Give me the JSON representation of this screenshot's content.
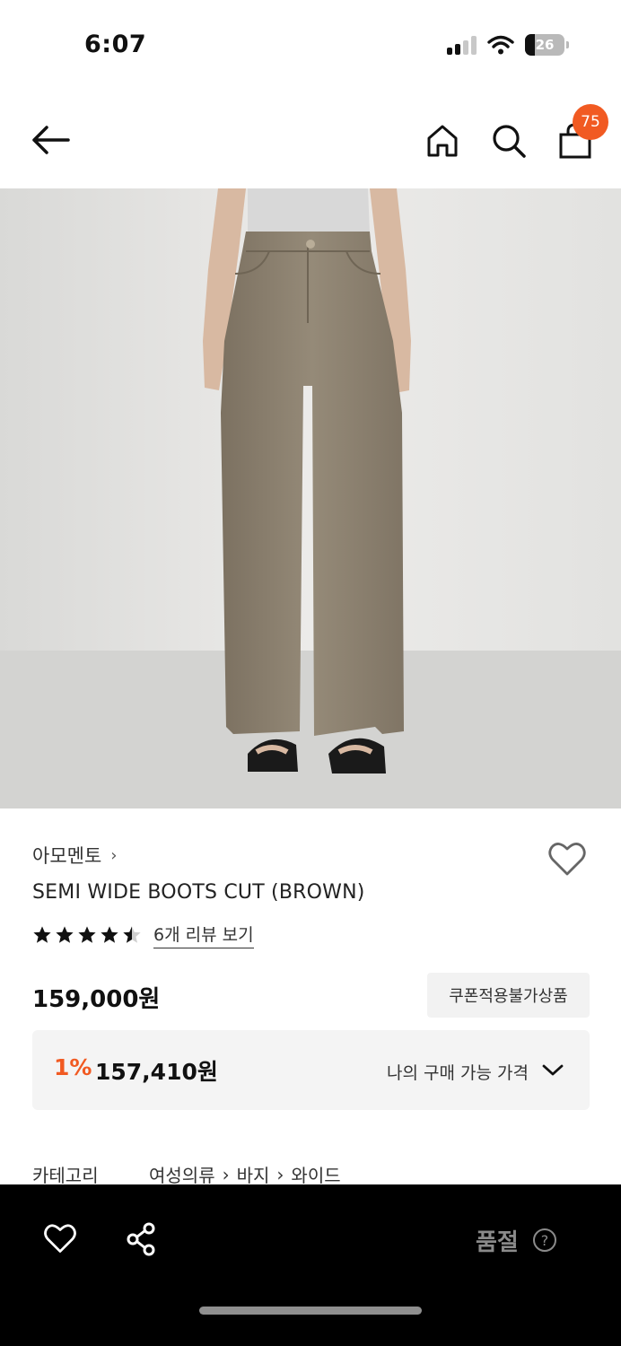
{
  "status": {
    "time": "6:07",
    "battery": "26"
  },
  "header": {
    "cart_count": "75"
  },
  "product": {
    "brand": "아모멘토",
    "title": "SEMI WIDE BOOTS CUT (BROWN)",
    "rating": 4.5,
    "review_link": "6개 리뷰 보기",
    "price": "159,000원",
    "coupon_badge": "쿠폰적용불가상품",
    "discount": {
      "rate": "1%",
      "price": "157,410원",
      "label": "나의 구매 가능 가격"
    }
  },
  "category": {
    "label": "카테고리",
    "path": [
      "여성의류",
      "바지",
      "와이드"
    ]
  },
  "bottom_bar": {
    "soldout_label": "품절",
    "help_symbol": "?"
  },
  "colors": {
    "accent": "#f15a22",
    "bottom_bar": "#000000",
    "image_bg": "#e4e4e2",
    "pants": "#8d8170"
  },
  "icons": [
    "back-arrow-icon",
    "home-icon",
    "search-icon",
    "shopping-bag-icon",
    "heart-icon",
    "star-icon",
    "chevron-down-icon",
    "share-icon",
    "help-icon"
  ]
}
